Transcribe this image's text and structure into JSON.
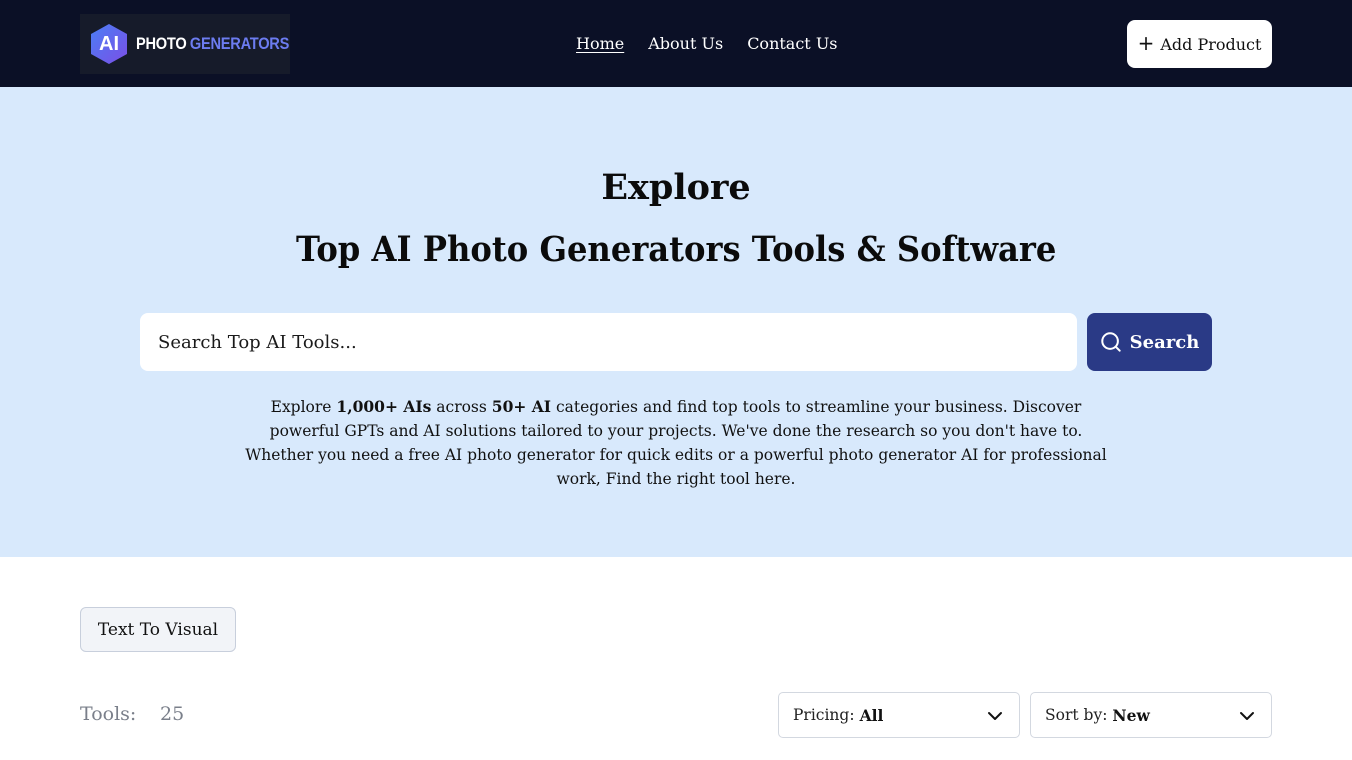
{
  "header": {
    "logo": {
      "badge": "AI",
      "word1": "PHOTO",
      "word2": "GENERATORS"
    },
    "nav": [
      {
        "label": "Home",
        "active": true
      },
      {
        "label": "About Us",
        "active": false
      },
      {
        "label": "Contact Us",
        "active": false
      }
    ],
    "add_button": {
      "icon": "plus-icon",
      "label": "Add Product"
    }
  },
  "hero": {
    "title_line1": "Explore",
    "title_line2": "Top AI Photo Generators Tools & Software",
    "search": {
      "placeholder": "Search Top AI Tools...",
      "button_label": "Search",
      "button_icon": "search-icon"
    },
    "description": {
      "p1": "Explore ",
      "b1": "1,000+ AIs",
      "p2": " across ",
      "b2": "50+ AI",
      "p3": " categories and find top tools to streamline your business. Discover powerful GPTs and AI solutions tailored to your projects. We've done the research so you don't have to. Whether you need a free AI photo generator for quick edits or a powerful photo generator AI for professional work, Find the right tool here."
    }
  },
  "filters": {
    "category_chip": "Text To Visual",
    "tools_label": "Tools:",
    "tools_count": "25",
    "pricing": {
      "label": "Pricing:",
      "value": "All"
    },
    "sort": {
      "label": "Sort by:",
      "value": "New"
    }
  },
  "colors": {
    "header_bg": "#0b1026",
    "hero_bg": "#d8e9fc",
    "search_button": "#2a3a86",
    "logo_accent": "#6c7cf0"
  }
}
